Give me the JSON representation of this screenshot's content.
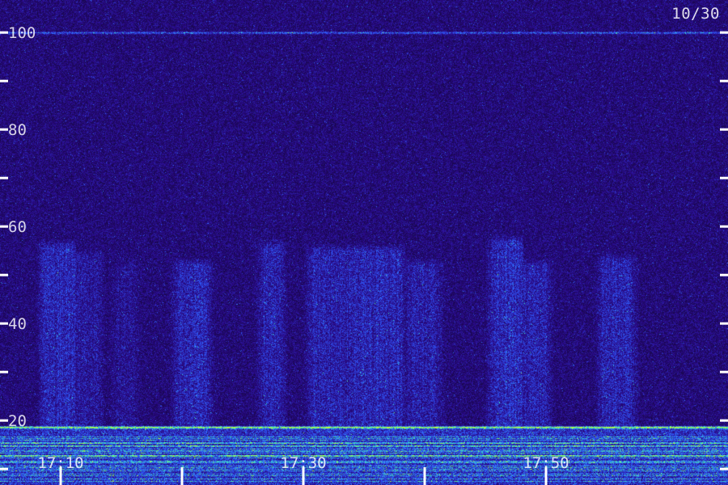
{
  "chart_data": {
    "type": "heatmap",
    "title": "",
    "date_label": "10/30",
    "xlabel": "",
    "ylabel": "",
    "x_ticks": [
      {
        "time": "17:10",
        "label": "17:10"
      },
      {
        "time": "17:20",
        "label": ""
      },
      {
        "time": "17:30",
        "label": "17:30"
      },
      {
        "time": "17:40",
        "label": ""
      },
      {
        "time": "17:50",
        "label": "17:50"
      }
    ],
    "y_ticks": [
      {
        "value": 10,
        "label": ""
      },
      {
        "value": 20,
        "label": "20"
      },
      {
        "value": 30,
        "label": ""
      },
      {
        "value": 40,
        "label": "40"
      },
      {
        "value": 50,
        "label": ""
      },
      {
        "value": 60,
        "label": "60"
      },
      {
        "value": 70,
        "label": ""
      },
      {
        "value": 80,
        "label": "80"
      },
      {
        "value": 90,
        "label": ""
      },
      {
        "value": 100,
        "label": "100"
      }
    ],
    "ylim": [
      6.7,
      106.7
    ],
    "xlim": [
      "17:05",
      "18:05"
    ],
    "grid": false,
    "colors": {
      "background": "#120636",
      "low": "#2a0a8a",
      "mid": "#2f5cff",
      "high": "#3cf0c0",
      "peak": "#b8ff3a"
    },
    "features": [
      {
        "kind": "horizontal_line",
        "value": 100,
        "intensity": 0.75
      },
      {
        "kind": "horizontal_line",
        "value": 18.6,
        "intensity": 1.0
      },
      {
        "kind": "noise_band",
        "from": 6.7,
        "to": 19,
        "intensity": 0.8
      },
      {
        "kind": "burst",
        "start": "17:09",
        "end": "17:10",
        "top": 56,
        "intensity": 0.65
      },
      {
        "kind": "burst",
        "start": "17:11",
        "end": "17:12",
        "top": 54,
        "intensity": 0.4
      },
      {
        "kind": "burst",
        "start": "17:15",
        "end": "17:15",
        "top": 52,
        "intensity": 0.3
      },
      {
        "kind": "burst",
        "start": "17:20",
        "end": "17:21",
        "top": 52,
        "intensity": 0.6
      },
      {
        "kind": "burst",
        "start": "17:27",
        "end": "17:27",
        "top": 56,
        "intensity": 0.55
      },
      {
        "kind": "burst",
        "start": "17:31",
        "end": "17:34",
        "top": 55,
        "intensity": 0.55
      },
      {
        "kind": "burst",
        "start": "17:35",
        "end": "17:37",
        "top": 55,
        "intensity": 0.65
      },
      {
        "kind": "burst",
        "start": "17:39",
        "end": "17:40",
        "top": 52,
        "intensity": 0.5
      },
      {
        "kind": "burst",
        "start": "17:46",
        "end": "17:47",
        "top": 57,
        "intensity": 0.7
      },
      {
        "kind": "burst",
        "start": "17:48",
        "end": "17:49",
        "top": 52,
        "intensity": 0.55
      },
      {
        "kind": "burst",
        "start": "17:55",
        "end": "17:56",
        "top": 53,
        "intensity": 0.6
      }
    ]
  }
}
